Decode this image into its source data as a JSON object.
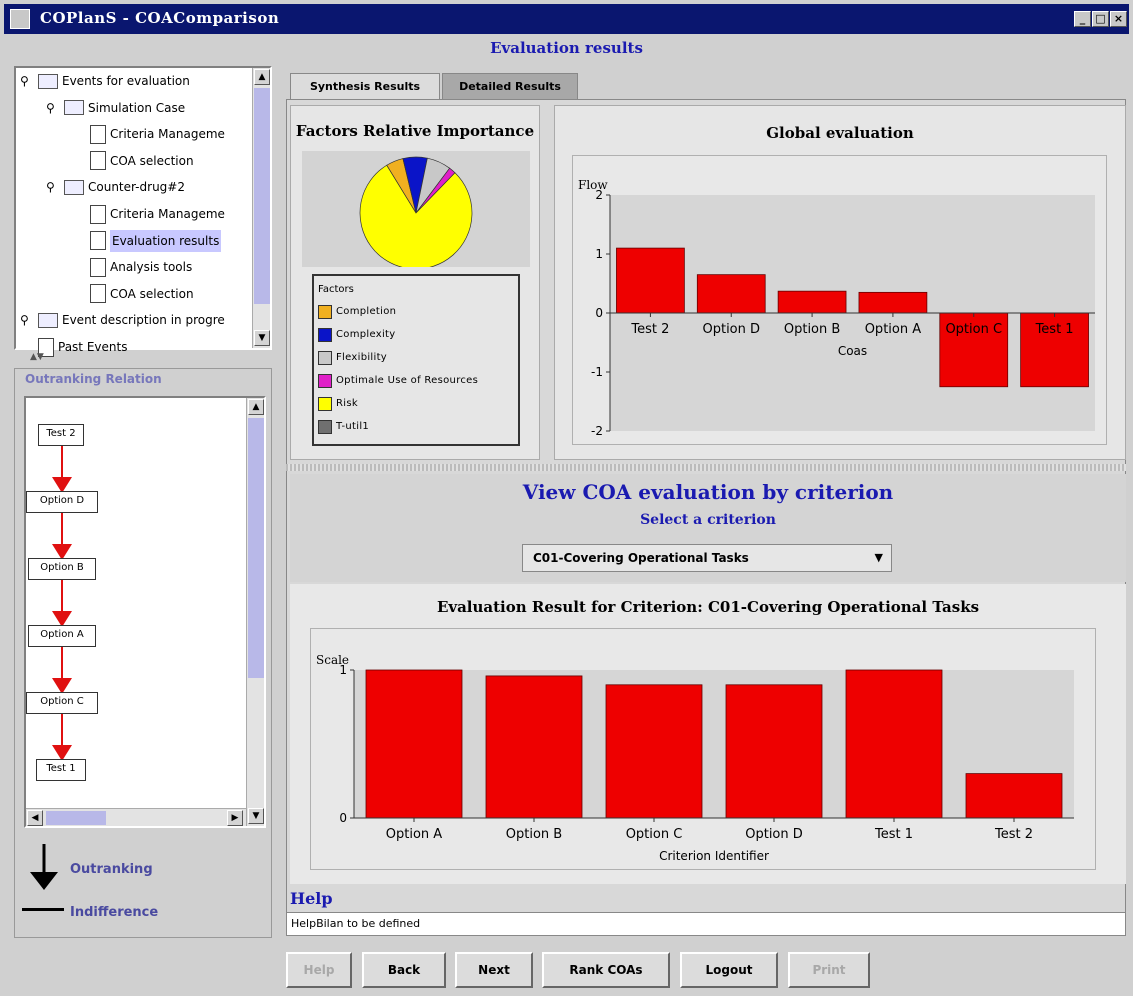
{
  "window": {
    "title": "COPlanS - COAComparison",
    "min_glyph": "_",
    "max_glyph": "□",
    "close_glyph": "×"
  },
  "header": {
    "title": "Evaluation results"
  },
  "tree": {
    "items": [
      {
        "label": "Events for evaluation",
        "level": 0,
        "type": "folder",
        "pin": "⚲"
      },
      {
        "label": "Simulation Case",
        "level": 1,
        "type": "folder",
        "pin": "⚲"
      },
      {
        "label": "Criteria Manageme",
        "level": 2,
        "type": "doc"
      },
      {
        "label": "COA selection",
        "level": 2,
        "type": "doc"
      },
      {
        "label": "Counter-drug#2",
        "level": 1,
        "type": "folder",
        "pin": "⚲"
      },
      {
        "label": "Criteria Manageme",
        "level": 2,
        "type": "doc"
      },
      {
        "label": "Evaluation results",
        "level": 2,
        "type": "doc",
        "selected": true
      },
      {
        "label": "Analysis tools",
        "level": 2,
        "type": "doc"
      },
      {
        "label": "COA selection",
        "level": 2,
        "type": "doc"
      },
      {
        "label": "Event description in progre",
        "level": 0,
        "type": "folder",
        "pin": "⚲"
      },
      {
        "label": "Past Events",
        "level": 0,
        "type": "doc"
      }
    ]
  },
  "outranking": {
    "title": "Outranking Relation",
    "nodes": [
      "Test 2",
      "Option D",
      "Option B",
      "Option A",
      "Option C",
      "Test 1"
    ],
    "legend_outranking": "Outranking",
    "legend_indifference": "Indifference",
    "edge_color": "#e01010"
  },
  "tabs": [
    {
      "label": "Synthesis Results",
      "active": true
    },
    {
      "label": "Detailed Results",
      "active": false
    }
  ],
  "factors": {
    "title": "Factors Relative Importance",
    "legend_title": "Factors",
    "items": [
      {
        "label": "Completion",
        "color": "#f0b020",
        "value": 0.05
      },
      {
        "label": "Complexity",
        "color": "#0a14c8",
        "value": 0.07
      },
      {
        "label": "Flexibility",
        "color": "#c8c8c8",
        "value": 0.07
      },
      {
        "label": "Optimale Use of Resources",
        "color": "#e020c8",
        "value": 0.02
      },
      {
        "label": "Risk",
        "color": "#ffff00",
        "value": 0.79
      },
      {
        "label": "T-util1",
        "color": "#707070",
        "value": 0.0
      }
    ]
  },
  "global": {
    "title": "Global evaluation",
    "chart_data": {
      "type": "bar",
      "categories": [
        "Test 2",
        "Option D",
        "Option B",
        "Option A",
        "Option C",
        "Test 1"
      ],
      "values": [
        1.1,
        0.65,
        0.37,
        0.35,
        -1.25,
        -1.25
      ],
      "ylabel": "Flow",
      "xlabel": "Coas",
      "ylim": [
        -2,
        2
      ],
      "yticks": [
        2,
        1,
        0,
        -1,
        -2
      ],
      "color": "#ee0000"
    }
  },
  "view": {
    "title": "View COA evaluation by criterion",
    "subtitle": "Select a criterion",
    "selected_criterion": "C01-Covering Operational Tasks",
    "dropdown_glyph": "▼"
  },
  "criterion_result": {
    "title": "Evaluation Result for Criterion: C01-Covering Operational Tasks",
    "chart_data": {
      "type": "bar",
      "categories": [
        "Option A",
        "Option B",
        "Option C",
        "Option D",
        "Test 1",
        "Test 2"
      ],
      "values": [
        1.0,
        0.96,
        0.9,
        0.9,
        1.0,
        0.3
      ],
      "ylabel": "Scale",
      "xlabel": "Criterion Identifier",
      "ylim": [
        0,
        1
      ],
      "yticks": [
        1,
        0
      ],
      "color": "#ee0000"
    }
  },
  "help": {
    "label": "Help",
    "text": "HelpBilan to be defined"
  },
  "buttons": [
    {
      "label": "Help",
      "enabled": false
    },
    {
      "label": "Back",
      "enabled": true
    },
    {
      "label": "Next",
      "enabled": true
    },
    {
      "label": "Rank COAs",
      "enabled": true
    },
    {
      "label": "Logout",
      "enabled": true
    },
    {
      "label": "Print",
      "enabled": false
    }
  ]
}
